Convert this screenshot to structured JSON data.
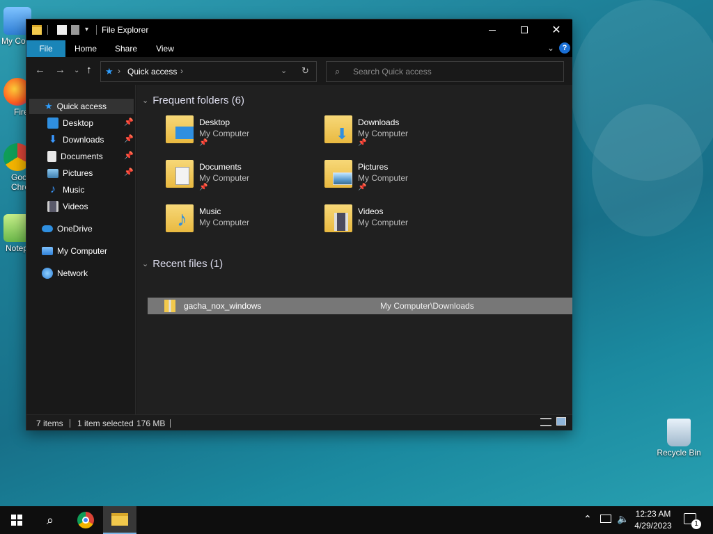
{
  "desktop": {
    "icons": [
      {
        "label": "My Co"
      },
      {
        "label": "Fire"
      },
      {
        "label": "Goo Chro"
      },
      {
        "label": "Notep"
      },
      {
        "label": "Recycle Bin"
      }
    ]
  },
  "window": {
    "title": "File Explorer",
    "ribbon_tabs": [
      "File",
      "Home",
      "Share",
      "View"
    ],
    "help_label": "?",
    "address": {
      "crumb": "Quick access"
    },
    "search": {
      "placeholder": "Search Quick access"
    }
  },
  "sidebar": {
    "items": [
      {
        "label": "Quick access",
        "pinned": false
      },
      {
        "label": "Desktop",
        "pinned": true
      },
      {
        "label": "Downloads",
        "pinned": true
      },
      {
        "label": "Documents",
        "pinned": true
      },
      {
        "label": "Pictures",
        "pinned": true
      },
      {
        "label": "Music",
        "pinned": false
      },
      {
        "label": "Videos",
        "pinned": false
      },
      {
        "label": "OneDrive",
        "pinned": false
      },
      {
        "label": "My Computer",
        "pinned": false
      },
      {
        "label": "Network",
        "pinned": false
      }
    ]
  },
  "content": {
    "frequent_header": "Frequent folders (6)",
    "folders": [
      {
        "name": "Desktop",
        "location": "My Computer",
        "pinned": true
      },
      {
        "name": "Downloads",
        "location": "My Computer",
        "pinned": true
      },
      {
        "name": "Documents",
        "location": "My Computer",
        "pinned": true
      },
      {
        "name": "Pictures",
        "location": "My Computer",
        "pinned": true
      },
      {
        "name": "Music",
        "location": "My Computer",
        "pinned": false
      },
      {
        "name": "Videos",
        "location": "My Computer",
        "pinned": false
      }
    ],
    "recent_header": "Recent files (1)",
    "recent_files": [
      {
        "name": "gacha_nox_windows",
        "path": "My Computer\\Downloads"
      }
    ]
  },
  "statusbar": {
    "items_count": "7 items",
    "selected": "1 item selected",
    "size": "176 MB"
  },
  "taskbar": {
    "time": "12:23 AM",
    "date": "4/29/2023",
    "notification_count": "1"
  },
  "colors": {
    "accent": "#1a85b8",
    "folder": "#f2c94c",
    "selection": "#777777"
  }
}
